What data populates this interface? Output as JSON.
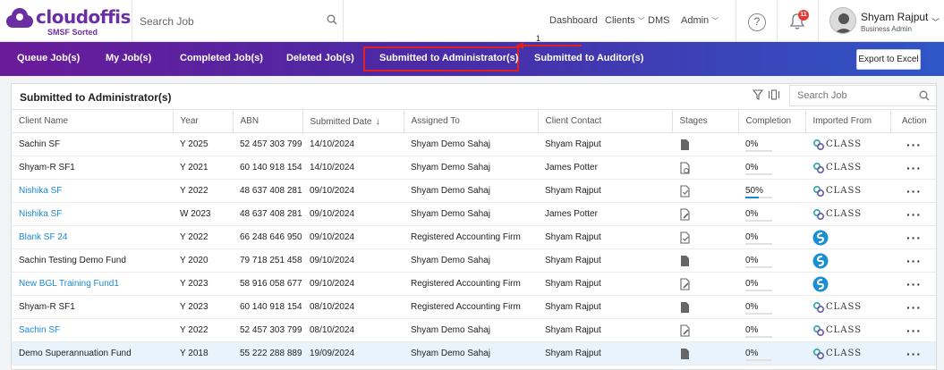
{
  "brand": {
    "name": "cloudoffis",
    "tagline": "SMSF Sorted",
    "color": "#6b2fa3"
  },
  "header": {
    "search_placeholder": "Search Job",
    "nav": [
      {
        "label": "Dashboard",
        "has_dropdown": false
      },
      {
        "label": "Clients",
        "has_dropdown": true
      },
      {
        "label": "DMS",
        "has_dropdown": false
      },
      {
        "label": "Admin",
        "has_dropdown": true
      }
    ],
    "help_icon": "question-circle-icon",
    "notification_count": "11",
    "user": {
      "name": "Shyam Rajput",
      "role": "Business Admin"
    }
  },
  "tabs": [
    {
      "label": "Queue Job(s)",
      "active": false
    },
    {
      "label": "My Job(s)",
      "active": false
    },
    {
      "label": "Completed Job(s)",
      "active": false
    },
    {
      "label": "Deleted Job(s)",
      "active": false
    },
    {
      "label": "Submitted to Administrator(s)",
      "active": true
    },
    {
      "label": "Submitted to Auditor(s)",
      "active": false
    }
  ],
  "export_label": "Export to Excel",
  "annotation": {
    "number": "1",
    "color": "#e02020"
  },
  "panel": {
    "title": "Submitted to Administrator(s)",
    "search_placeholder": "Search Job",
    "columns": [
      "Client Name",
      "Year",
      "ABN",
      "Submitted Date",
      "Assigned To",
      "Client Contact",
      "Stages",
      "Completion",
      "Imported From",
      "Action"
    ],
    "sorted_column": "Submitted Date",
    "rows": [
      {
        "client": "Sachin SF",
        "link": false,
        "year": "Y 2025",
        "abn": "52 457 303 799",
        "date": "14/10/2024",
        "assigned": "Shyam Demo Sahaj",
        "contact": "Shyam Rajput",
        "stage_icon": "document-icon",
        "completion": "0%",
        "completion_value": 0,
        "imported": "class-logo",
        "imported_text": "CLASS"
      },
      {
        "client": "Shyam-R SF1",
        "link": false,
        "year": "Y 2021",
        "abn": "60 140 918 154",
        "date": "14/10/2024",
        "assigned": "Shyam Demo Sahaj",
        "contact": "James Potter",
        "stage_icon": "document-clock-icon",
        "completion": "0%",
        "completion_value": 0,
        "imported": "class-logo",
        "imported_text": "CLASS"
      },
      {
        "client": "Nishika SF",
        "link": true,
        "year": "Y 2022",
        "abn": "48 637 408 281",
        "date": "09/10/2024",
        "assigned": "Shyam Demo Sahaj",
        "contact": "Shyam Rajput",
        "stage_icon": "document-check-icon",
        "completion": "50%",
        "completion_value": 50,
        "imported": "class-logo",
        "imported_text": "CLASS"
      },
      {
        "client": "Nishika SF",
        "link": true,
        "year": "W 2023",
        "abn": "48 637 408 281",
        "date": "09/10/2024",
        "assigned": "Shyam Demo Sahaj",
        "contact": "James Potter",
        "stage_icon": "document-edit-icon",
        "completion": "0%",
        "completion_value": 0,
        "imported": "class-logo",
        "imported_text": "CLASS"
      },
      {
        "client": "Blank SF 24",
        "link": true,
        "year": "Y 2022",
        "abn": "66 248 646 950",
        "date": "09/10/2024",
        "assigned": "Registered Accounting Firm",
        "contact": "Shyam Rajput",
        "stage_icon": "document-check-icon",
        "completion": "0%",
        "completion_value": 0,
        "imported": "bgl-logo",
        "imported_text": ""
      },
      {
        "client": "Sachin Testing Demo Fund",
        "link": false,
        "year": "Y 2020",
        "abn": "79 718 251 458",
        "date": "09/10/2024",
        "assigned": "Shyam Demo Sahaj",
        "contact": "Shyam Rajput",
        "stage_icon": "document-icon",
        "completion": "0%",
        "completion_value": 0,
        "imported": "bgl-logo",
        "imported_text": ""
      },
      {
        "client": "New BGL Training Fund1",
        "link": true,
        "year": "Y 2023",
        "abn": "58 916 058 677",
        "date": "09/10/2024",
        "assigned": "Registered Accounting Firm",
        "contact": "Shyam Rajput",
        "stage_icon": "document-edit-icon",
        "completion": "0%",
        "completion_value": 0,
        "imported": "bgl-logo",
        "imported_text": ""
      },
      {
        "client": "Shyam-R SF1",
        "link": false,
        "year": "Y 2023",
        "abn": "60 140 918 154",
        "date": "08/10/2024",
        "assigned": "Registered Accounting Firm",
        "contact": "Shyam Rajput",
        "stage_icon": "document-icon",
        "completion": "0%",
        "completion_value": 0,
        "imported": "class-logo",
        "imported_text": "CLASS"
      },
      {
        "client": "Sachin SF",
        "link": true,
        "year": "Y 2022",
        "abn": "52 457 303 799",
        "date": "08/10/2024",
        "assigned": "Shyam Demo Sahaj",
        "contact": "Shyam Rajput",
        "stage_icon": "document-edit-icon",
        "completion": "0%",
        "completion_value": 0,
        "imported": "class-logo",
        "imported_text": "CLASS"
      },
      {
        "client": "Demo Superannuation Fund",
        "link": false,
        "year": "Y 2018",
        "abn": "55 222 288 889",
        "date": "19/09/2024",
        "assigned": "Shyam Demo Sahaj",
        "contact": "Shyam Rajput",
        "stage_icon": "document-icon",
        "completion": "0%",
        "completion_value": 0,
        "imported": "class-logo",
        "imported_text": "CLASS",
        "highlighted": true
      }
    ]
  }
}
